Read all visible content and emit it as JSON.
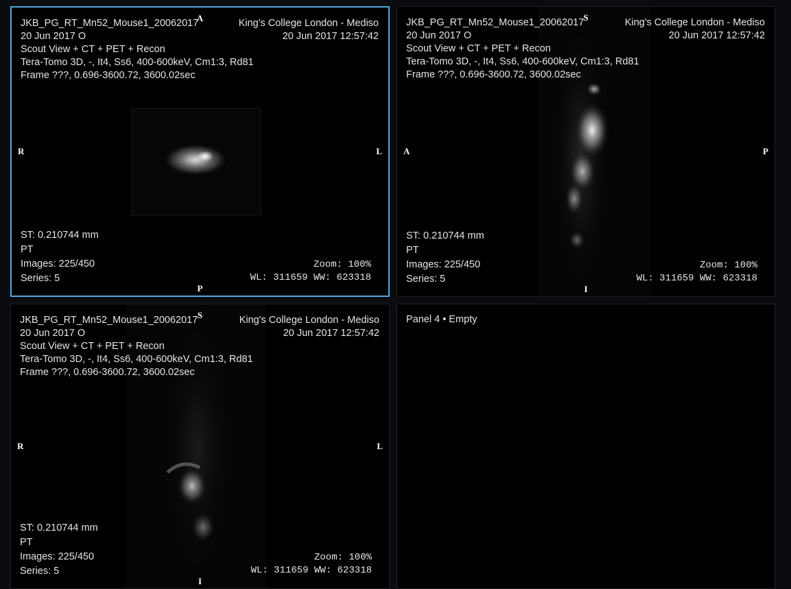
{
  "overlay": {
    "patient": "JKB_PG_RT_Mn52_Mouse1_20062017",
    "date_line": "20 Jun 2017 O",
    "series_desc": "Scout View + CT + PET + Recon",
    "recon_params": "Tera-Tomo 3D, -, It4, Ss6, 400-600keV, Cm1:3, Rd81",
    "frame": "Frame ???, 0.696-3600.72, 3600.02sec",
    "institution": "King's College London - Mediso",
    "study_datetime": "20 Jun 2017 12:57:42",
    "slice_thickness": "ST: 0.210744 mm",
    "modality": "PT",
    "images": "Images: 225/450",
    "series": "Series: 5",
    "zoom": "Zoom: 100%",
    "window": "WL: 311659 WW: 623318"
  },
  "panels": [
    {
      "id": "axial",
      "active": true,
      "orientation": {
        "top": "A",
        "bottom": "P",
        "left": "R",
        "right": "L"
      }
    },
    {
      "id": "sagittal",
      "active": false,
      "orientation": {
        "top": "S",
        "bottom": "I",
        "left": "A",
        "right": "P"
      }
    },
    {
      "id": "coronal",
      "active": false,
      "orientation": {
        "top": "S",
        "bottom": "I",
        "left": "R",
        "right": "L"
      }
    }
  ],
  "empty_panel": {
    "label": "Panel 4 • Empty"
  },
  "colors": {
    "active_border": "#4fa9e0",
    "background": "#0b0c10"
  }
}
